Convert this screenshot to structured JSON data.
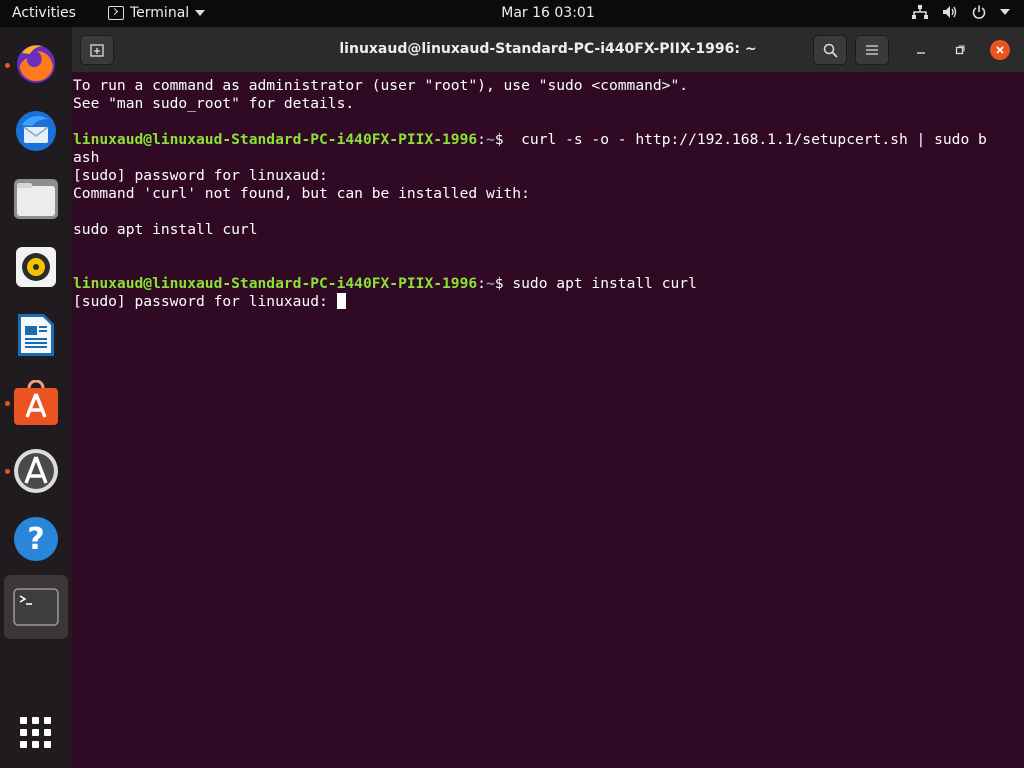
{
  "topbar": {
    "activities": "Activities",
    "app_name": "Terminal",
    "datetime": "Mar 16  03:01"
  },
  "dock": {
    "items": [
      {
        "name": "firefox",
        "running": true
      },
      {
        "name": "thunderbird",
        "running": false
      },
      {
        "name": "files",
        "running": false
      },
      {
        "name": "rhythmbox",
        "running": false
      },
      {
        "name": "libreoffice-writer",
        "running": false
      },
      {
        "name": "ubuntu-software",
        "running": true
      },
      {
        "name": "software-updater",
        "running": true
      },
      {
        "name": "help",
        "running": false
      },
      {
        "name": "terminal",
        "running": true,
        "active": true
      }
    ],
    "show_apps": "show-applications"
  },
  "window": {
    "title": "linuxaud@linuxaud-Standard-PC-i440FX-PIIX-1996: ~"
  },
  "terminal": {
    "line1": "To run a command as administrator (user \"root\"), use \"sudo <command>\".",
    "line2": "See \"man sudo_root\" for details.",
    "prompt_user": "linuxaud@linuxaud-Standard-PC-i440FX-PIIX-1996",
    "prompt_sep": ":",
    "prompt_path": "~",
    "prompt_end": "$",
    "cmd1": "  curl -s -o - http://192.168.1.1/setupcert.sh | sudo b",
    "cmd1_wrap": "ash",
    "out1": "[sudo] password for linuxaud:",
    "out2": "Command 'curl' not found, but can be installed with:",
    "out3": "sudo apt install curl",
    "cmd2": " sudo apt install curl",
    "out4": "[sudo] password for linuxaud: "
  },
  "colors": {
    "terminal_bg": "#300a24",
    "prompt_user": "#8ae234",
    "prompt_path": "#729fcf",
    "accent": "#e95420"
  }
}
